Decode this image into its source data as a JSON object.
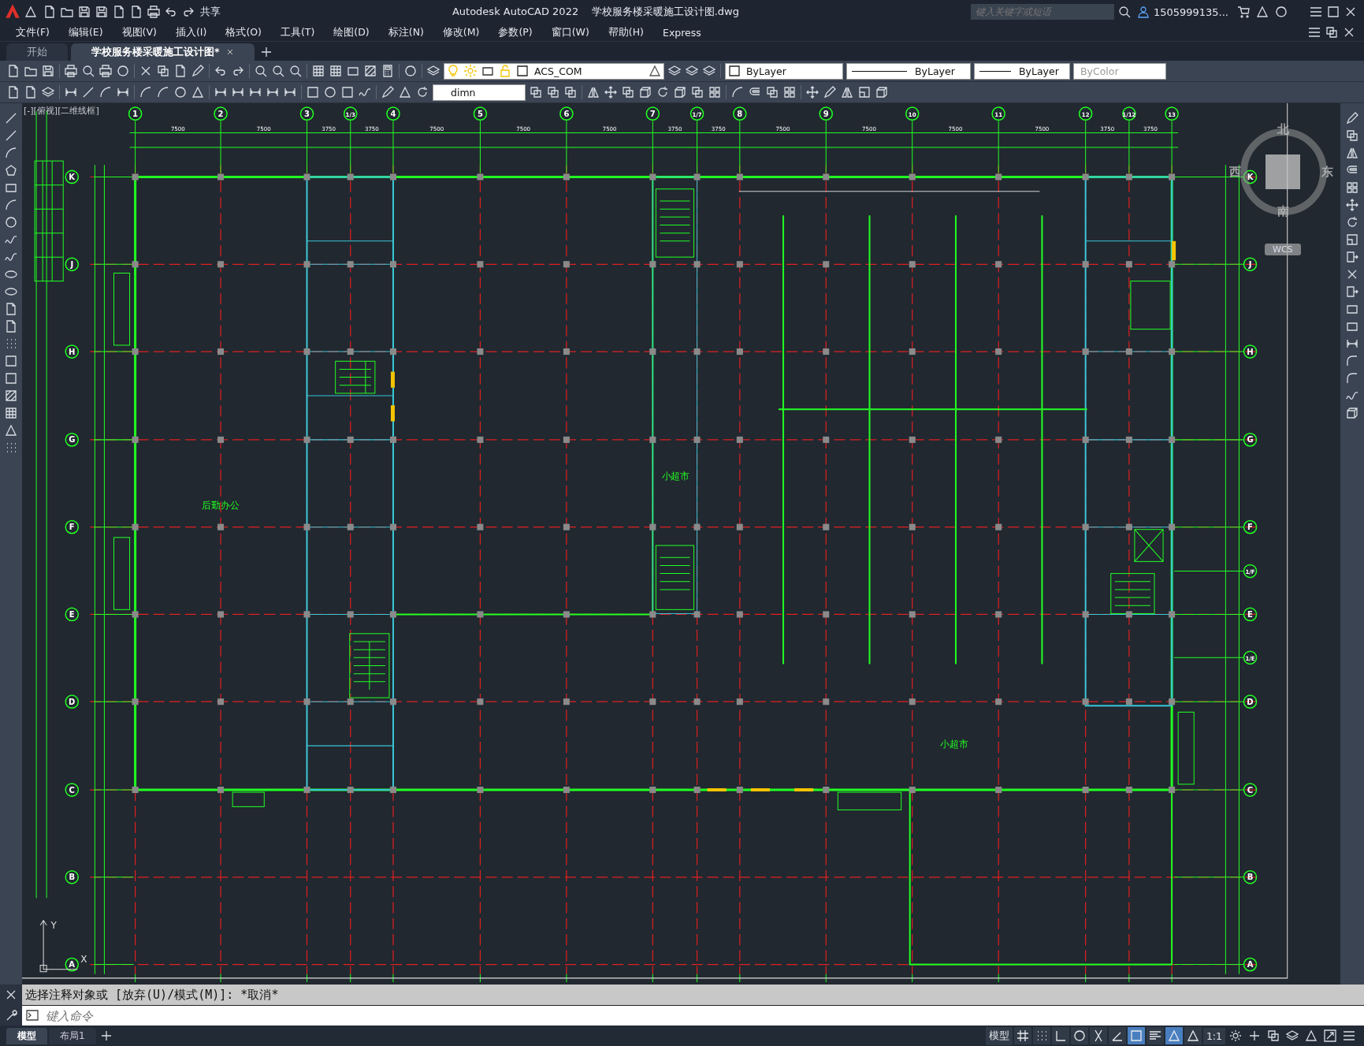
{
  "window": {
    "app_title": "Autodesk AutoCAD 2022",
    "file_title": "学校服务楼采暖施工设计图.dwg"
  },
  "quick_access": {
    "share_label": "共享"
  },
  "search": {
    "placeholder": "键入关键字或短语"
  },
  "user": {
    "name": "1505999135..."
  },
  "menu": [
    "文件(F)",
    "编辑(E)",
    "视图(V)",
    "插入(I)",
    "格式(O)",
    "工具(T)",
    "绘图(D)",
    "标注(N)",
    "修改(M)",
    "参数(P)",
    "窗口(W)",
    "帮助(H)",
    "Express"
  ],
  "doc_tabs": [
    {
      "label": "开始",
      "selected": false
    },
    {
      "label": "学校服务楼采暖施工设计图*",
      "selected": true
    }
  ],
  "properties": {
    "layer": "ACS_COM",
    "color_setting": "ByLayer",
    "linetype": "ByLayer",
    "lineweight": "ByLayer",
    "plot_style": {
      "value": "ByColor",
      "disabled": true
    }
  },
  "dim_style": "dimn",
  "viewport_label": "[-][俯视][二维线框]",
  "viewcube": {
    "north": "北",
    "south": "南",
    "east": "东",
    "west": "西",
    "coordinate_system": "WCS"
  },
  "drawing": {
    "column_axes": [
      "1",
      "2",
      "3",
      "1/3",
      "4",
      "5",
      "6",
      "7",
      "1/7",
      "8",
      "9",
      "10",
      "11",
      "12",
      "1/12",
      "13"
    ],
    "row_axes": [
      "K",
      "J",
      "H",
      "G",
      "F",
      "E",
      "D",
      "C",
      "B",
      "A"
    ],
    "right_row_axes": [
      "K",
      "J",
      "H",
      "G",
      "F",
      "1/F",
      "E",
      "1/E",
      "D",
      "C",
      "B",
      "A"
    ],
    "top_dimensions": [
      "7500",
      "7500",
      "3750",
      "3750",
      "7500",
      "7500",
      "7500",
      "3750",
      "3750",
      "7500",
      "7500",
      "7500",
      "7500",
      "3750",
      "3750"
    ],
    "room_labels": [
      "后勤办公",
      "小超市",
      "小超市"
    ],
    "ucs_x_label": "X",
    "ucs_y_label": "Y"
  },
  "command_line": {
    "history": "选择注释对象或 [放弃(U)/模式(M)]: *取消*",
    "placeholder": "键入命令"
  },
  "layout_tabs": [
    {
      "label": "模型",
      "selected": true
    },
    {
      "label": "布局1",
      "selected": false
    }
  ],
  "status_bar": {
    "model_label": "模型",
    "scale": "1:1",
    "toggles": [
      {
        "kind": "grid",
        "on": false
      },
      {
        "kind": "snap",
        "on": false
      },
      {
        "kind": "ortho",
        "on": false
      },
      {
        "kind": "polar",
        "on": false
      },
      {
        "kind": "isodraft",
        "on": false
      },
      {
        "kind": "track",
        "on": false
      },
      {
        "kind": "osnap",
        "on": true
      },
      {
        "kind": "lineweight",
        "on": false
      },
      {
        "kind": "annotation",
        "on": true
      },
      {
        "kind": "autoscale",
        "on": false
      }
    ]
  }
}
